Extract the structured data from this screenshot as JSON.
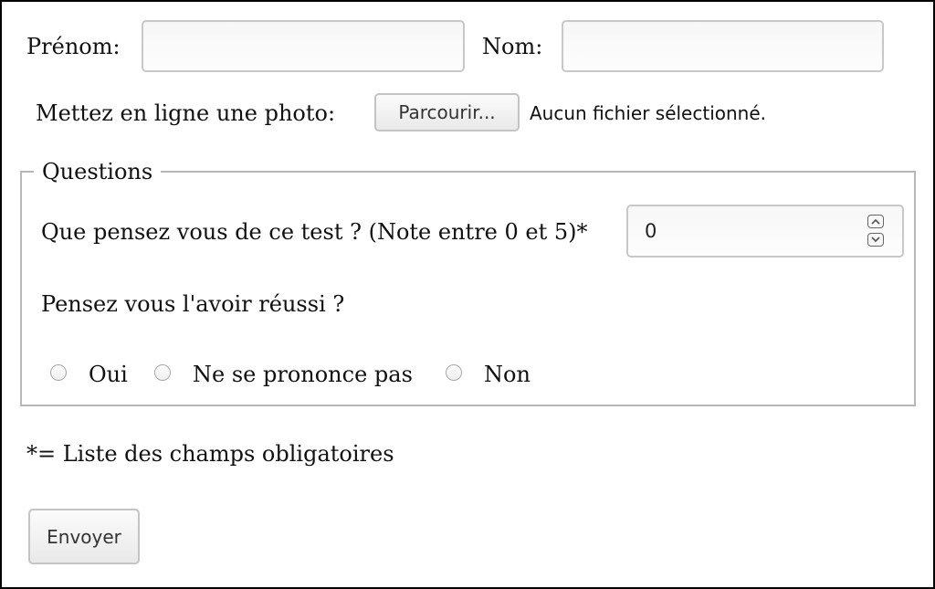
{
  "form": {
    "prenom_label": "Prénom:",
    "prenom_value": "",
    "nom_label": "Nom:",
    "nom_value": "",
    "photo_label": "Mettez en ligne une photo:",
    "browse_label": "Parcourir...",
    "file_status": "Aucun fichier sélectionné.",
    "required_note": "*= Liste des champs obligatoires",
    "submit_label": "Envoyer"
  },
  "questions": {
    "legend": "Questions",
    "rating_question": "Que pensez vous de ce test ? (Note entre 0 et 5)*",
    "rating_value": "0",
    "success_question": "Pensez vous l'avoir réussi ?",
    "options": [
      {
        "label": "Oui",
        "checked": false
      },
      {
        "label": "Ne se prononce pas",
        "checked": false
      },
      {
        "label": "Non",
        "checked": false
      }
    ]
  },
  "icons": {
    "spin_up": "chevron-up-icon",
    "spin_down": "chevron-down-icon"
  }
}
